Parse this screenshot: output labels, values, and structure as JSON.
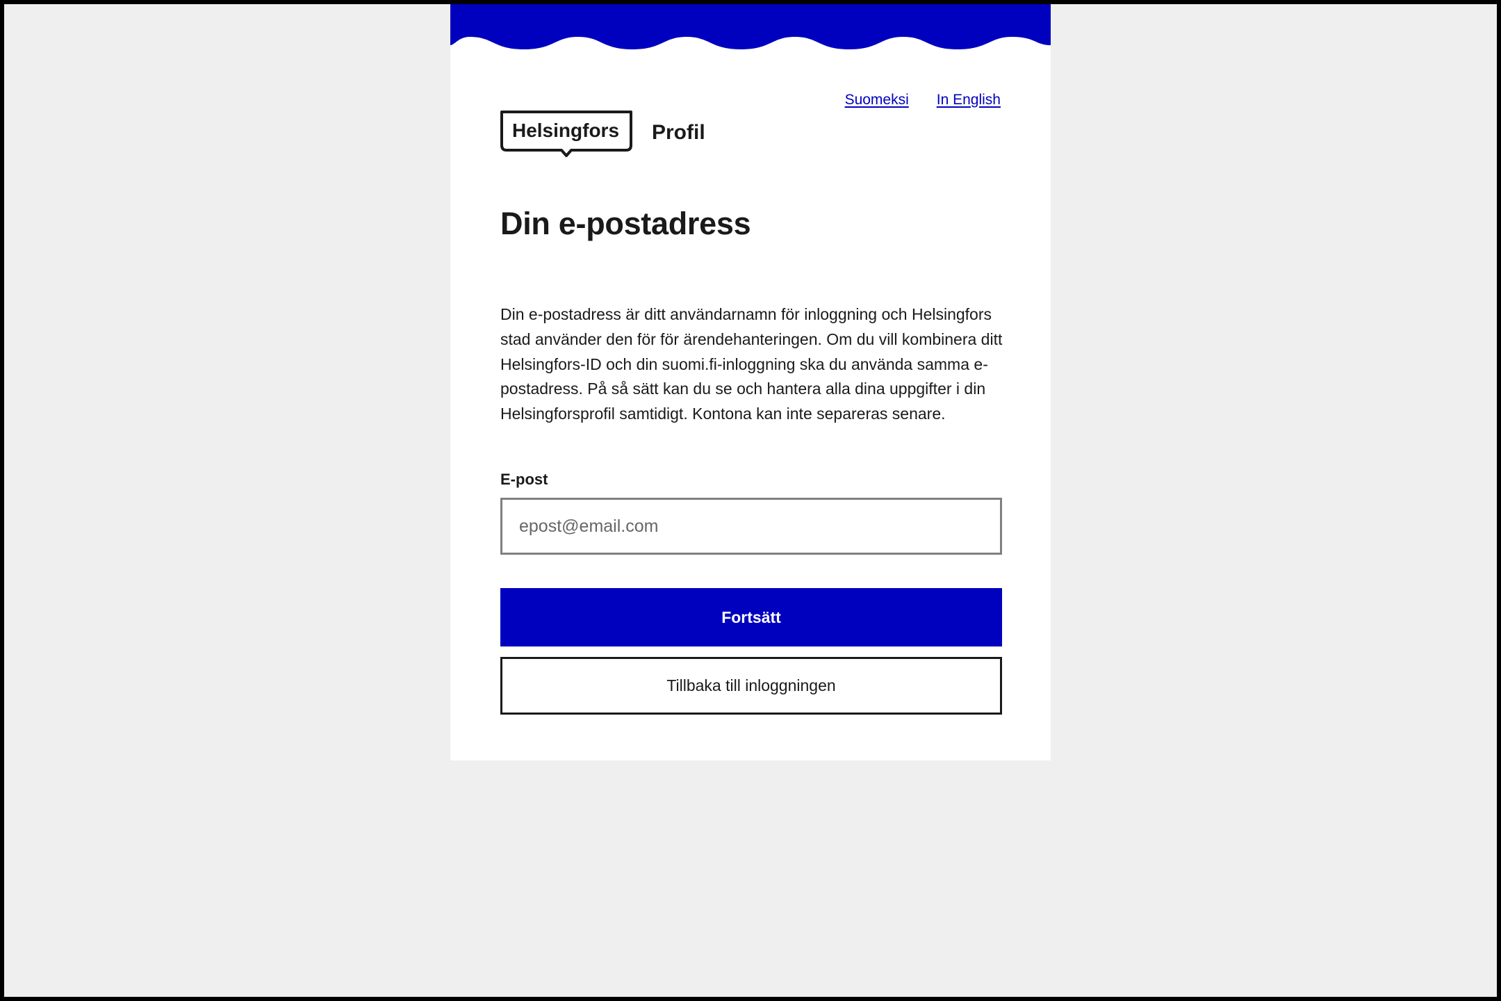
{
  "colors": {
    "brand_blue": "#0000bf",
    "page_background": "#efefef",
    "card_background": "#ffffff",
    "text": "#1a1a1a",
    "input_border": "#808080"
  },
  "language_links": [
    {
      "label": "Suomeksi"
    },
    {
      "label": "In English"
    }
  ],
  "header": {
    "logo_text": "Helsingfors",
    "app_name": "Profil"
  },
  "main": {
    "title": "Din e-postadress",
    "description": "Din e-postadress är ditt användarnamn för inloggning och Helsingfors stad använder den för för ärendehanteringen. Om du vill kombinera ditt Helsingfors-ID och din suomi.fi-inloggning ska du använda samma e-postadress. På så sätt kan du se och hantera alla dina uppgifter i din Helsingforsprofil samtidigt. Kontona kan inte separeras senare."
  },
  "form": {
    "email_label": "E-post",
    "email_placeholder": "epost@email.com",
    "email_value": ""
  },
  "buttons": {
    "continue_label": "Fortsätt",
    "back_label": "Tillbaka till inloggningen"
  }
}
